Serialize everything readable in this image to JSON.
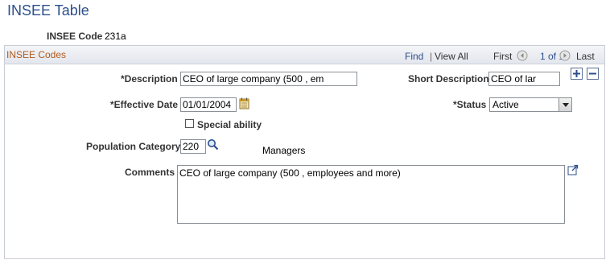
{
  "page": {
    "title": "INSEE Table"
  },
  "insee": {
    "code_label": "INSEE Code",
    "code_value": "231a"
  },
  "grid": {
    "title": "INSEE Codes",
    "find": "Find",
    "separator": "|",
    "view_all": "View All",
    "first": "First",
    "count": "1 of 1",
    "last": "Last"
  },
  "form": {
    "description_label": "*Description",
    "description_value": "CEO of large company (500 , em",
    "short_description_label": "Short Description",
    "short_description_value": "CEO of lar",
    "effective_date_label": "*Effective Date",
    "effective_date_value": "01/01/2004",
    "status_label": "*Status",
    "status_value": "Active",
    "special_ability_label": "Special ability",
    "population_category_label": "Population Category",
    "population_category_value": "220",
    "population_category_desc": "Managers",
    "comments_label": "Comments",
    "comments_value": "CEO of large company (500 , employees and more)"
  },
  "icons": {
    "add": "plus-icon",
    "delete": "minus-icon",
    "calendar": "calendar-icon",
    "lookup": "magnifier-icon",
    "expand": "expand-icon",
    "prev": "prev-arrow-icon",
    "next": "next-arrow-icon"
  },
  "colors": {
    "title": "#2c4f8c",
    "grid_title": "#b05a1c",
    "link": "#2c4f8c"
  }
}
